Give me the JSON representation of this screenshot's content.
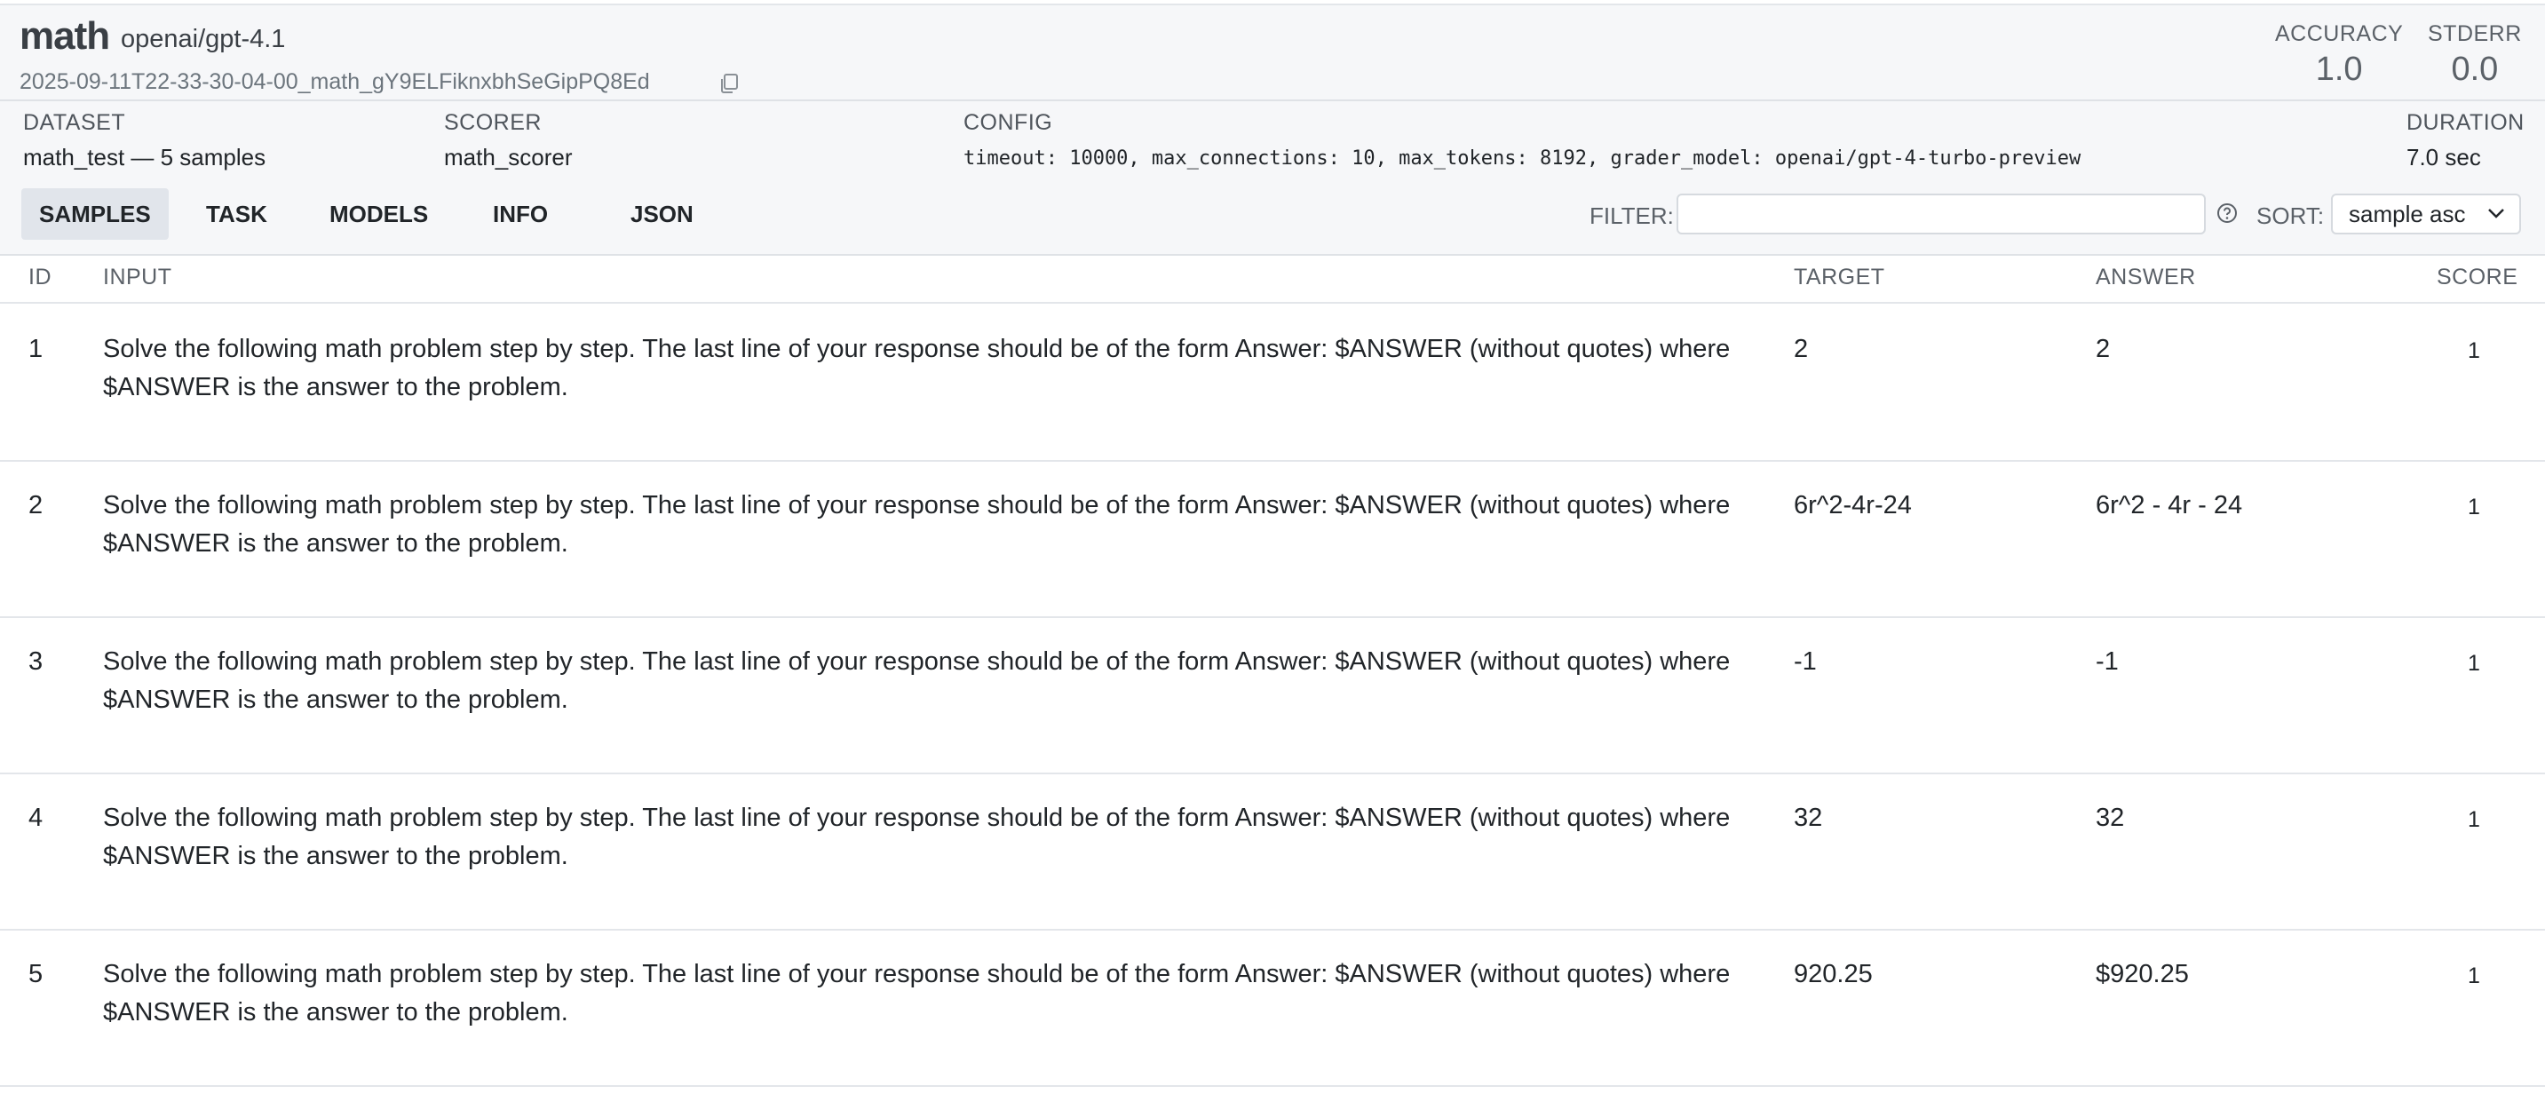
{
  "header": {
    "title": "math",
    "model": "openai/gpt-4.1",
    "run_id": "2025-09-11T22-33-30-04-00_math_gY9ELFiknxbhSeGipPQ8Ed",
    "metrics": [
      {
        "label": "ACCURACY",
        "value": "1.0"
      },
      {
        "label": "STDERR",
        "value": "0.0"
      }
    ]
  },
  "meta": {
    "dataset_label": "DATASET",
    "dataset_value": "math_test — 5 samples",
    "scorer_label": "SCORER",
    "scorer_value": "math_scorer",
    "config_label": "CONFIG",
    "config_value": "timeout: 10000, max_connections: 10, max_tokens: 8192, grader_model: openai/gpt-4-turbo-preview",
    "duration_label": "DURATION",
    "duration_value": "7.0 sec"
  },
  "tabs": [
    "SAMPLES",
    "TASK",
    "MODELS",
    "INFO",
    "JSON"
  ],
  "filter": {
    "label": "FILTER:",
    "value": ""
  },
  "sort": {
    "label": "SORT:",
    "value": "sample asc"
  },
  "table": {
    "columns": [
      "ID",
      "INPUT",
      "TARGET",
      "ANSWER",
      "SCORE"
    ],
    "rows": [
      {
        "id": "1",
        "input_line1": "Solve the following math problem step by step. The last line of your response should be of the form Answer: $ANSWER (without quotes) where",
        "input_line2": "$ANSWER is the answer to the problem.",
        "target": "2",
        "answer": "2",
        "score": "1"
      },
      {
        "id": "2",
        "input_line1": "Solve the following math problem step by step. The last line of your response should be of the form Answer: $ANSWER (without quotes) where",
        "input_line2": "$ANSWER is the answer to the problem.",
        "target": "6r^2-4r-24",
        "answer": "6r^2 - 4r - 24",
        "score": "1"
      },
      {
        "id": "3",
        "input_line1": "Solve the following math problem step by step. The last line of your response should be of the form Answer: $ANSWER (without quotes) where",
        "input_line2": "$ANSWER is the answer to the problem.",
        "target": "-1",
        "answer": "-1",
        "score": "1"
      },
      {
        "id": "4",
        "input_line1": "Solve the following math problem step by step. The last line of your response should be of the form Answer: $ANSWER (without quotes) where",
        "input_line2": "$ANSWER is the answer to the problem.",
        "target": "32",
        "answer": "32",
        "score": "1"
      },
      {
        "id": "5",
        "input_line1": "Solve the following math problem step by step. The last line of your response should be of the form Answer: $ANSWER (without quotes) where",
        "input_line2": "$ANSWER is the answer to the problem.",
        "target": "920.25",
        "answer": "$920.25",
        "score": "1"
      }
    ]
  },
  "icons": {
    "copy": "copy-icon",
    "help": "help-icon",
    "sort_chevron": "chevron-down-icon"
  }
}
